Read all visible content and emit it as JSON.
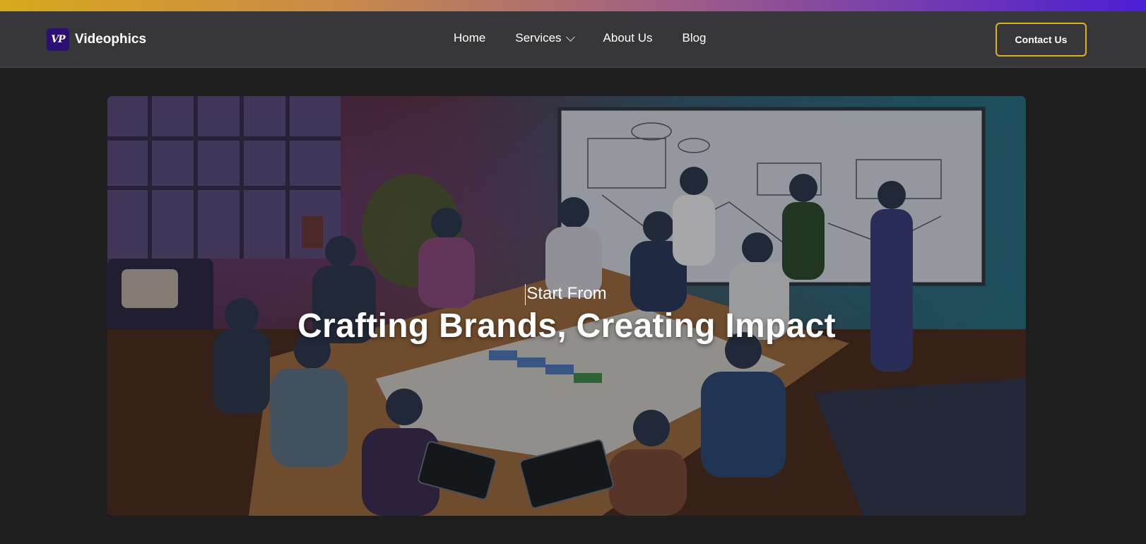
{
  "brand": {
    "logo_text": "VP",
    "name": "Videophics"
  },
  "nav": {
    "items": [
      {
        "label": "Home"
      },
      {
        "label": "Services",
        "has_dropdown": true
      },
      {
        "label": "About Us"
      },
      {
        "label": "Blog"
      }
    ],
    "cta_label": "Contact Us"
  },
  "hero": {
    "subtitle": "Start From",
    "title": "Crafting Brands, Creating Impact",
    "image_icon": "office-meeting-illustration"
  },
  "colors": {
    "nav_bg": "#37373a",
    "page_bg": "#1e1e1e",
    "cta_border": "#d9b31a",
    "logo_bg": "#2b0f73"
  }
}
